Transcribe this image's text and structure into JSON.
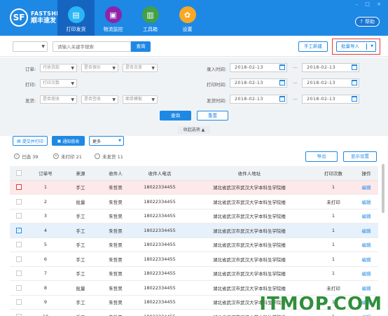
{
  "app": {
    "brand_en": "FASTSHIP",
    "brand_cn": "顺丰速发",
    "logo_mark": "SF",
    "help_label": "帮助",
    "window_controls": "– □ ×"
  },
  "nav": [
    {
      "label": "打印发货",
      "icon": "printer-icon",
      "color": "#29b6f6",
      "glyph": "▤",
      "active": true
    },
    {
      "label": "物流监控",
      "icon": "monitor-icon",
      "color": "#8e24aa",
      "glyph": "▣",
      "active": false
    },
    {
      "label": "工具箱",
      "icon": "toolbox-icon",
      "color": "#43a047",
      "glyph": "▥",
      "active": false
    },
    {
      "label": "设置",
      "icon": "gear-icon",
      "color": "#f9a825",
      "glyph": "✿",
      "active": false
    }
  ],
  "search": {
    "placeholder": "请输入关键字搜索",
    "button": "查询"
  },
  "actions": {
    "manual_create": "手工新建",
    "batch_import": "批量导入"
  },
  "filters": {
    "order_label": "订单:",
    "print_label": "打印:",
    "ship_label": "发货:",
    "order_sel1": "代收货款",
    "order_sel2": "是否保价",
    "order_sel3": "是否合单",
    "print_sel1": "打印次数",
    "ship_sel1": "是否揽收",
    "ship_sel2": "是否签收",
    "ship_sel3": "面单模板",
    "entry_time_label": "录入时间:",
    "print_time_label": "打印时间:",
    "ship_time_label": "发货时间:",
    "date": "2018-02-13",
    "query_button": "查询",
    "reset_button": "重置",
    "collapse": "收起选项 ▲"
  },
  "toolbar": {
    "submit_print": "提交并打印",
    "notify_pickup": "通知揽收",
    "more": "更多",
    "export": "导出",
    "display_settings": "显示设置"
  },
  "stats": {
    "selected": "已选 39",
    "unprinted": "未打印 21",
    "unshipped": "未发货 11"
  },
  "table": {
    "headers": [
      "",
      "订单号",
      "来源",
      "收件人",
      "收件人电话",
      "收件人地址",
      "打印次数",
      "操作"
    ],
    "rows": [
      {
        "no": "1",
        "src": "手工",
        "name": "朱哲昊",
        "phone": "18022334455",
        "addr": "湖北省武汉市武汉大学本科生学院楼",
        "prints": "1",
        "op": "编辑",
        "state": "pink"
      },
      {
        "no": "2",
        "src": "批量",
        "name": "朱哲昊",
        "phone": "18022334455",
        "addr": "湖北省武汉市武汉大学本科生学院楼",
        "prints": "未打印",
        "op": "编辑",
        "state": ""
      },
      {
        "no": "3",
        "src": "手工",
        "name": "朱哲昊",
        "phone": "18022334455",
        "addr": "湖北省武汉市武汉大学本科生学院楼",
        "prints": "1",
        "op": "编辑",
        "state": ""
      },
      {
        "no": "4",
        "src": "手工",
        "name": "朱哲昊",
        "phone": "18022334455",
        "addr": "湖北省武汉市武汉大学本科生学院楼",
        "prints": "1",
        "op": "编辑",
        "state": "blue"
      },
      {
        "no": "5",
        "src": "手工",
        "name": "朱哲昊",
        "phone": "18022334455",
        "addr": "湖北省武汉市武汉大学本科生学院楼",
        "prints": "1",
        "op": "编辑",
        "state": ""
      },
      {
        "no": "6",
        "src": "手工",
        "name": "朱哲昊",
        "phone": "18022334455",
        "addr": "湖北省武汉市武汉大学本科生学院楼",
        "prints": "1",
        "op": "编辑",
        "state": ""
      },
      {
        "no": "7",
        "src": "手工",
        "name": "朱哲昊",
        "phone": "18022334455",
        "addr": "湖北省武汉市武汉大学本科生学院楼",
        "prints": "1",
        "op": "编辑",
        "state": ""
      },
      {
        "no": "8",
        "src": "批量",
        "name": "朱哲昊",
        "phone": "18022334455",
        "addr": "湖北省武汉市武汉大学本科生学院楼",
        "prints": "未打印",
        "op": "编辑",
        "state": ""
      },
      {
        "no": "9",
        "src": "手工",
        "name": "朱哲昊",
        "phone": "18022334455",
        "addr": "湖北省武汉市武汉大学本科生学院楼",
        "prints": "1",
        "op": "编辑",
        "state": ""
      },
      {
        "no": "10",
        "src": "手工",
        "name": "朱哲昊",
        "phone": "18022334455",
        "addr": "湖北省武汉市武汉大学本科生学院楼",
        "prints": "1",
        "op": "编辑",
        "state": ""
      }
    ]
  },
  "watermark": "ITMOP.COM"
}
